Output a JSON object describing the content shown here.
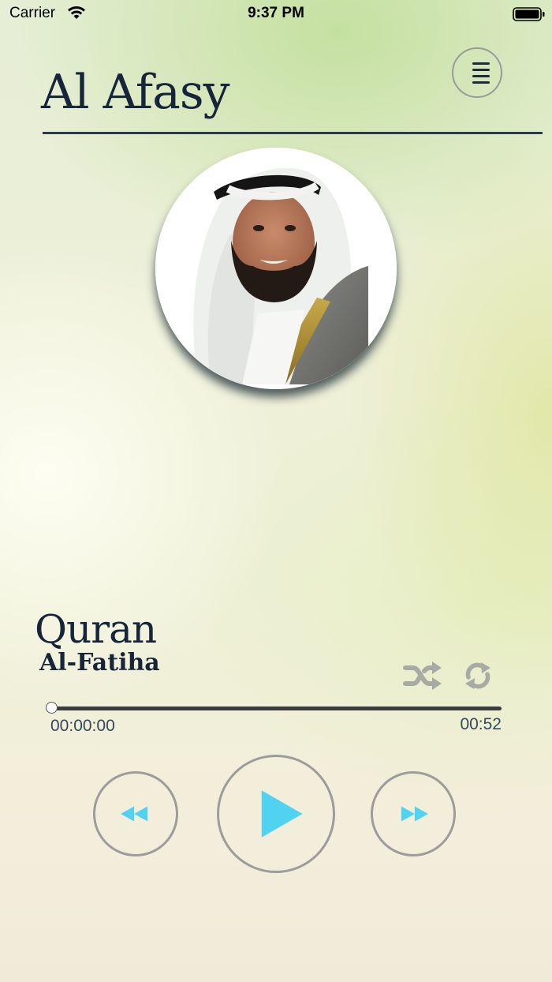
{
  "status_bar": {
    "carrier": "Carrier",
    "time": "9:37 PM",
    "icons": [
      "wifi-icon",
      "battery-icon"
    ]
  },
  "header": {
    "title": "Al Afasy",
    "menu_icon": "menu-list-icon"
  },
  "reciter_photo": {
    "description_icon": "reciter-portrait"
  },
  "now_playing": {
    "album": "Quran",
    "track": "Al-Fatiha"
  },
  "playback": {
    "current_time": "00:00:00",
    "total_time": "00:52",
    "progress_fraction": 0.0,
    "shuffle_icon": "shuffle-icon",
    "repeat_icon": "repeat-icon"
  },
  "controls": {
    "rewind_icon": "rewind-icon",
    "play_icon": "play-icon",
    "forward_icon": "fast-forward-icon"
  },
  "colors": {
    "accent": "#4fd3f0",
    "title": "#16253a",
    "icon_muted": "#a8aaa4",
    "ring": "#9c9c9c"
  }
}
